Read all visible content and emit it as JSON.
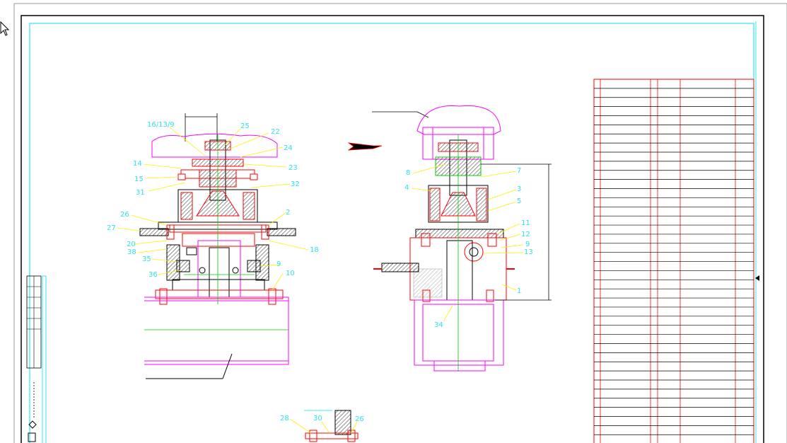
{
  "drawing": {
    "left_view_labels": [
      "16/13/9",
      "25",
      "22",
      "24",
      "14",
      "23",
      "15",
      "31",
      "32",
      "26",
      "2",
      "27",
      "20",
      "18",
      "38",
      "35",
      "9",
      "36",
      "10"
    ],
    "right_view_labels": [
      "8",
      "7",
      "4",
      "3",
      "5",
      "11",
      "12",
      "9",
      "13",
      "1",
      "34"
    ],
    "bottom_view_labels": [
      "28",
      "30",
      "26"
    ]
  },
  "parts_list": {
    "rows": 41
  },
  "colors": {
    "border": "#000000",
    "frame": "#00e5ee",
    "outline": "#ff00ff",
    "part": "#ff0000",
    "centerline": "#00cc00",
    "leader": "#ffee00",
    "hatch": "#333333"
  }
}
